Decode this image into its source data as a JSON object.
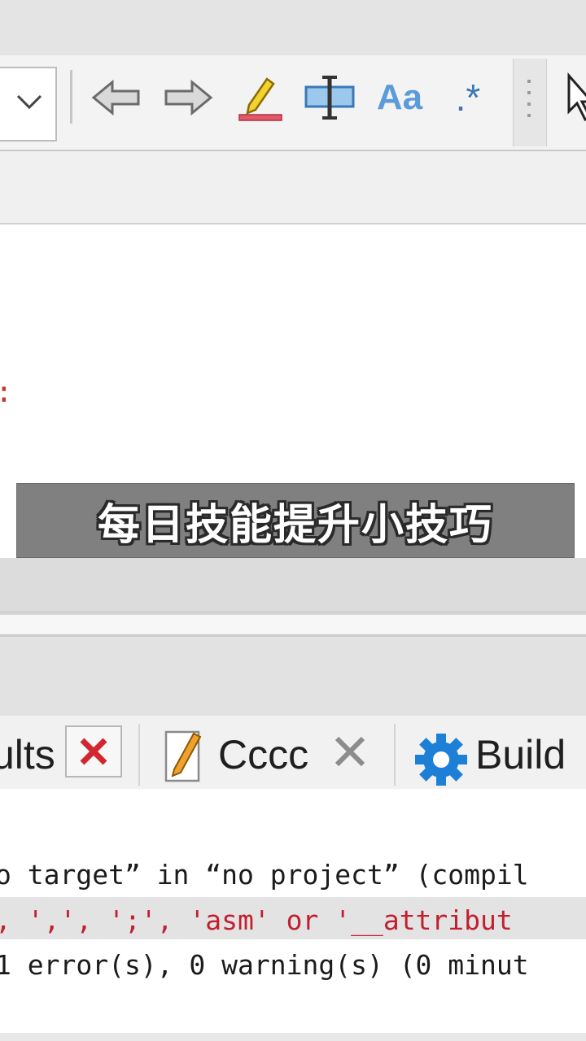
{
  "toolbar": {
    "buttons": [
      {
        "name": "back-arrow-icon"
      },
      {
        "name": "forward-arrow-icon"
      },
      {
        "name": "highlight-pen-icon"
      },
      {
        "name": "select-text-icon"
      },
      {
        "name": "match-case-icon",
        "label": "Aa"
      },
      {
        "name": "regex-icon",
        "label": ".*"
      },
      {
        "name": "cursor-icon"
      }
    ]
  },
  "editor": {
    "fragment": ":"
  },
  "subtitle": {
    "text": "每日技能提升小技巧"
  },
  "bottom_tabs": {
    "results_label": "ults",
    "cccc_label": "Cccc",
    "build_label": "Build"
  },
  "output": {
    "lines": [
      "o target” in “no project” (compil",
      ", ',', ';', 'asm' or '__attribut",
      "1 error(s), 0 warning(s) (0 minut"
    ]
  },
  "colors": {
    "error_text": "#c2202e",
    "subtitle_bg": "#808080",
    "build_gear": "#1e7fd6",
    "close_red": "#d22630"
  }
}
